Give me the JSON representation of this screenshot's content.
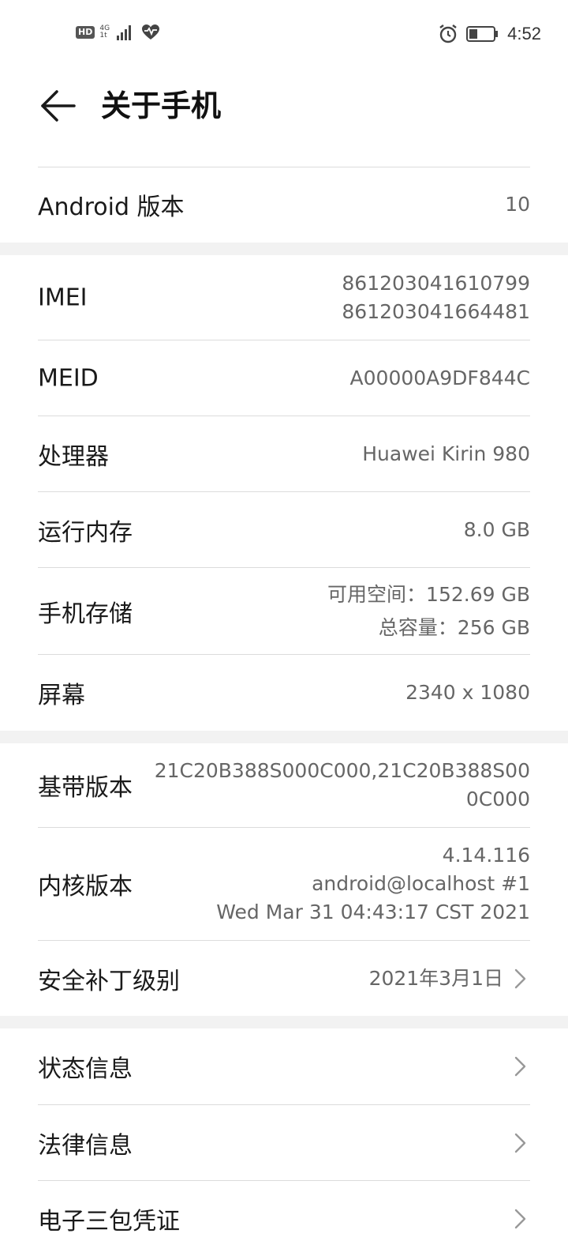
{
  "status_bar": {
    "hd": "HD",
    "net_type": "4G",
    "net_sub": "1t",
    "time": "4:52",
    "icons": [
      "signal-icon",
      "heart-health-icon",
      "alarm-icon",
      "battery-icon"
    ]
  },
  "header": {
    "title": "关于手机"
  },
  "items": {
    "android": {
      "label": "Android 版本",
      "value": "10"
    },
    "imei": {
      "label": "IMEI",
      "value_1": "861203041610799",
      "value_2": "861203041664481"
    },
    "meid": {
      "label": "MEID",
      "value": "A00000A9DF844C"
    },
    "cpu": {
      "label": "处理器",
      "value": "Huawei Kirin 980"
    },
    "ram": {
      "label": "运行内存",
      "value": "8.0 GB"
    },
    "storage": {
      "label": "手机存储",
      "value_1": "可用空间：152.69  GB",
      "value_2": "总容量：256  GB"
    },
    "screen": {
      "label": "屏幕",
      "value": "2340 x 1080"
    },
    "baseband": {
      "label": "基带版本",
      "value_1": "21C20B388S000C000,21C20B388S00",
      "value_2": "0C000"
    },
    "kernel": {
      "label": "内核版本",
      "value_1": "4.14.116",
      "value_2": "android@localhost #1",
      "value_3": "Wed Mar 31 04:43:17 CST 2021"
    },
    "patch": {
      "label": "安全补丁级别",
      "value": "2021年3月1日"
    },
    "status_info": {
      "label": "状态信息"
    },
    "legal": {
      "label": "法律信息"
    },
    "warranty": {
      "label": "电子三包凭证"
    }
  },
  "colors": {
    "background": "#ffffff",
    "section_gap": "#f2f2f2",
    "label": "#1a1a1a",
    "value": "#666666",
    "divider": "#dcdcdc"
  }
}
